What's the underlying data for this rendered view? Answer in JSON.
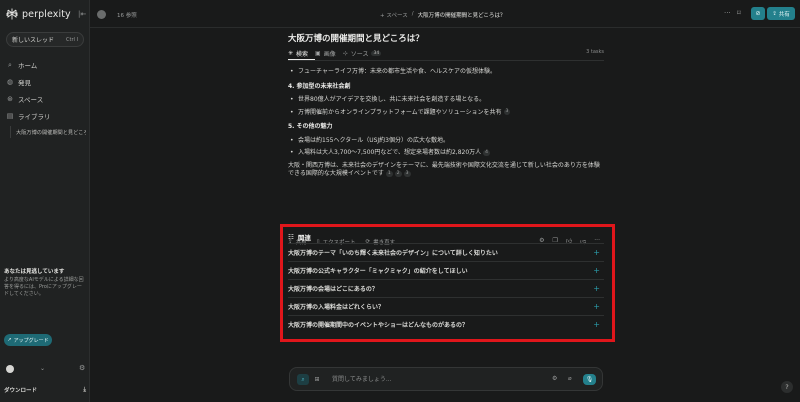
{
  "sidebar": {
    "logo_text": "perplexity",
    "new_thread_label": "新しいスレッド",
    "new_thread_kbd": "Ctrl  I",
    "nav": [
      {
        "label": "ホーム",
        "icon": "search-icon"
      },
      {
        "label": "発見",
        "icon": "globe-icon"
      },
      {
        "label": "スペース",
        "icon": "spaces-icon"
      },
      {
        "label": "ライブラリ",
        "icon": "library-icon"
      }
    ],
    "library_item": "大阪万博の開催期間と見どころは？",
    "promo_title": "あなたは見逃しています",
    "promo_body": "より高度なAIモデルによる詳細な回答を得るには、Proにアップグレードしてください。",
    "upgrade_label": "アップグレード",
    "download_label": "ダウンロード"
  },
  "topbar": {
    "views": "16 参照",
    "crumb_space": "+ スペース",
    "crumb_sep": "/",
    "crumb_current": "大阪万博の開催期間と見どころは？",
    "share_label": "共有"
  },
  "main": {
    "title": "大阪万博の開催期間と見どころは？",
    "tabs": [
      {
        "label": "検索",
        "icon": "perplexity-icon"
      },
      {
        "label": "画像",
        "icon": "image-icon"
      },
      {
        "label": "ソース",
        "icon": "sources-icon",
        "badge": "34"
      }
    ],
    "tasks": "3 tasks",
    "answer": {
      "top_bullet": "フューチャーライフ万博：未来の都市生活や食、ヘルスケアの仮想体験。",
      "section4_heading": "4. 参加型の未来社会創",
      "section4_bullets": [
        {
          "text": "世界80億人がアイデアを交換し、共に未来社会を創造する場となる。",
          "cite": ""
        },
        {
          "text": "万博開催前からオンラインプラットフォームで課題やソリューションを共有",
          "cite": "3"
        }
      ],
      "section5_heading": "5. その他の魅力",
      "section5_bullets": [
        {
          "text": "会場は約155ヘクタール（USJ約3個分）の広大な敷地。",
          "cite": ""
        },
        {
          "text": "入場料は大人3,700〜7,500円などで、想定来場者数は約2,820万人",
          "cite": "4"
        }
      ],
      "summary": "大阪・関西万博は、未来社会のデザインをテーマに、最先端技術や国際文化交流を通じて新しい社会のあり方を体験できる国際的な大規模イベントです",
      "summary_cites": [
        "1",
        "2",
        "3"
      ]
    },
    "actions": {
      "share": "共有",
      "export": "エクスポート",
      "rewrite": "書き直す"
    },
    "related": {
      "heading": "関連",
      "items": [
        "大阪万博のテーマ「いのち輝く未来社会のデザイン」について詳しく知りたい",
        "大阪万博の公式キャラクター「ミャクミャク」の紹介をしてほしい",
        "大阪万博の会場はどこにあるの？",
        "大阪万博の入場料金はどれくらい？",
        "大阪万博の開催期間中のイベントやショーはどんなものがあるの？"
      ]
    },
    "composer": {
      "placeholder": "質問してみましょう..."
    }
  },
  "colors": {
    "accent": "#23808c",
    "highlight_box": "#e0161b",
    "background": "#191a1a",
    "sidebar": "#202222"
  }
}
